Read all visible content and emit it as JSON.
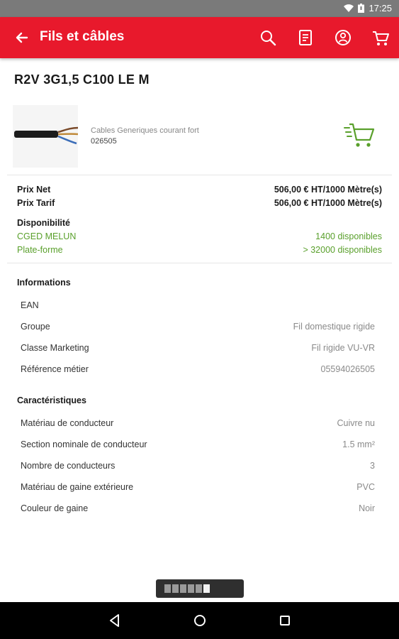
{
  "status_bar": {
    "time": "17:25"
  },
  "app_bar": {
    "title": "Fils et câbles",
    "icons": [
      "back-arrow-icon",
      "search-icon",
      "document-icon",
      "account-icon",
      "cart-icon"
    ],
    "color": "#e8192c"
  },
  "product": {
    "title": "R2V 3G1,5 C100 LE M",
    "category": "Cables Generiques courant fort",
    "code": "026505"
  },
  "prices": [
    {
      "label": "Prix Net",
      "value": "506,00 € HT/1000 Mètre(s)"
    },
    {
      "label": "Prix Tarif",
      "value": "506,00 € HT/1000 Mètre(s)"
    }
  ],
  "availability": {
    "title": "Disponibilité",
    "items": [
      {
        "place": "CGED MELUN",
        "qty": "1400 disponibles"
      },
      {
        "place": "Plate-forme",
        "qty": "> 32000 disponibles"
      }
    ],
    "color": "#5aa02c"
  },
  "informations": {
    "title": "Informations",
    "rows": [
      {
        "key": "EAN",
        "value": ""
      },
      {
        "key": "Groupe",
        "value": "Fil domestique rigide"
      },
      {
        "key": "Classe Marketing",
        "value": "Fil rigide VU-VR"
      },
      {
        "key": "Référence métier",
        "value": "05594026505"
      }
    ]
  },
  "caracteristiques": {
    "title": "Caractéristiques",
    "rows": [
      {
        "key": "Matériau de conducteur",
        "value": "Cuivre nu"
      },
      {
        "key": "Section nominale de conducteur",
        "value": "1.5 mm²"
      },
      {
        "key": "Nombre de conducteurs",
        "value": "3"
      },
      {
        "key": "Matériau de gaine extérieure",
        "value": "PVC"
      },
      {
        "key": "Couleur de gaine",
        "value": "Noir"
      }
    ]
  },
  "scroll_indicator": {
    "pages": 6,
    "current": 5
  }
}
